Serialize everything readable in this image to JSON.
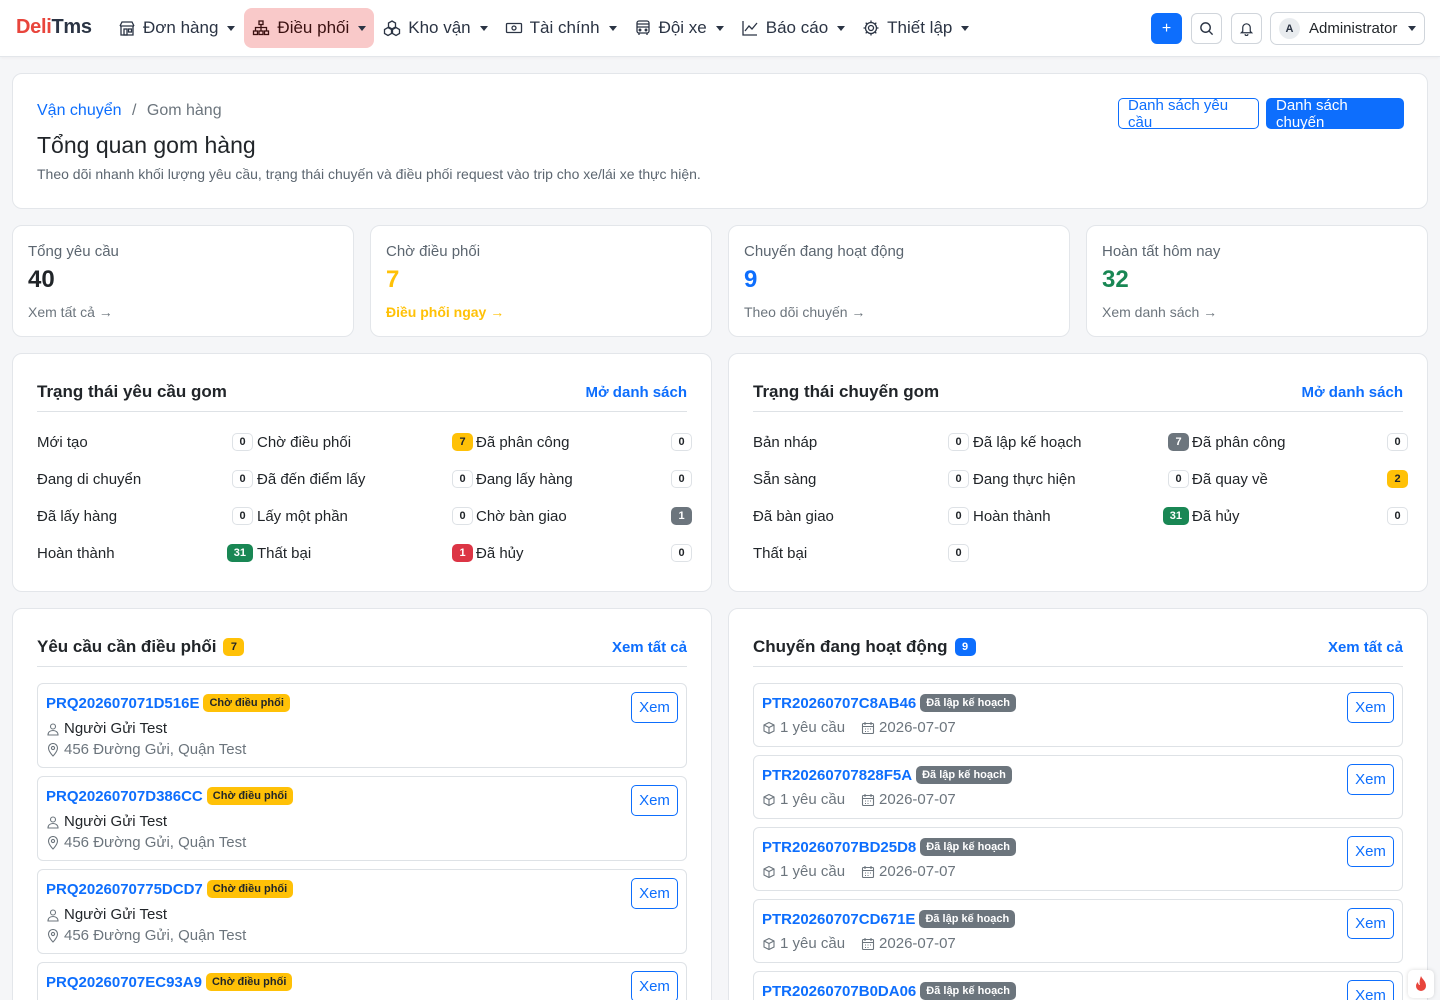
{
  "brand": {
    "part1": "Deli",
    "part2": "Tms"
  },
  "nav": [
    {
      "label": "Đơn hàng",
      "icon": "store-icon",
      "active": false
    },
    {
      "label": "Điều phối",
      "icon": "sitemap-icon",
      "active": true
    },
    {
      "label": "Kho vận",
      "icon": "boxes-icon",
      "active": false
    },
    {
      "label": "Tài chính",
      "icon": "cash-icon",
      "active": false
    },
    {
      "label": "Đội xe",
      "icon": "bus-icon",
      "active": false
    },
    {
      "label": "Báo cáo",
      "icon": "chart-line-icon",
      "active": false
    },
    {
      "label": "Thiết lập",
      "icon": "gear-icon",
      "active": false
    }
  ],
  "topbar": {
    "add_label": "+",
    "user_initial": "A",
    "user_name": "Administrator"
  },
  "header": {
    "breadcrumb_root": "Vận chuyển",
    "breadcrumb_sep": "/",
    "breadcrumb_current": "Gom hàng",
    "title": "Tổng quan gom hàng",
    "description": "Theo dõi nhanh khối lượng yêu cầu, trạng thái chuyến và điều phối request vào trip cho xe/lái xe thực hiện.",
    "btn_requests": "Danh sách yêu cầu",
    "btn_trips": "Danh sách chuyến"
  },
  "stats": [
    {
      "label": "Tổng yêu cầu",
      "value": "40",
      "link": "Xem tất cả →",
      "color": "#212529",
      "link_color": "#6c757d"
    },
    {
      "label": "Chờ điều phối",
      "value": "7",
      "link": "Điều phối ngay →",
      "color": "#ffc107",
      "link_color": "#ffc107"
    },
    {
      "label": "Chuyến đang hoạt động",
      "value": "9",
      "link": "Theo dõi chuyến →",
      "color": "#0d6efd",
      "link_color": "#6c757d"
    },
    {
      "label": "Hoàn tất hôm nay",
      "value": "32",
      "link": "Xem danh sách →",
      "color": "#198754",
      "link_color": "#6c757d"
    }
  ],
  "request_status": {
    "title": "Trạng thái yêu cầu gom",
    "link": "Mở danh sách",
    "items": [
      {
        "label": "Mới tạo",
        "count": "0",
        "style": ""
      },
      {
        "label": "Chờ điều phối",
        "count": "7",
        "style": "y"
      },
      {
        "label": "Đã phân công",
        "count": "0",
        "style": ""
      },
      {
        "label": "Đang di chuyển",
        "count": "0",
        "style": ""
      },
      {
        "label": "Đã đến điểm lấy",
        "count": "0",
        "style": ""
      },
      {
        "label": "Đang lấy hàng",
        "count": "0",
        "style": ""
      },
      {
        "label": "Đã lấy hàng",
        "count": "0",
        "style": ""
      },
      {
        "label": "Lấy một phần",
        "count": "0",
        "style": ""
      },
      {
        "label": "Chờ bàn giao",
        "count": "1",
        "style": "gr"
      },
      {
        "label": "Hoàn thành",
        "count": "31",
        "style": "g"
      },
      {
        "label": "Thất bại",
        "count": "1",
        "style": "r"
      },
      {
        "label": "Đã hủy",
        "count": "0",
        "style": ""
      }
    ]
  },
  "trip_status": {
    "title": "Trạng thái chuyến gom",
    "link": "Mở danh sách",
    "items": [
      {
        "label": "Bản nháp",
        "count": "0",
        "style": ""
      },
      {
        "label": "Đã lập kế hoạch",
        "count": "7",
        "style": "gr"
      },
      {
        "label": "Đã phân công",
        "count": "0",
        "style": ""
      },
      {
        "label": "Sẵn sàng",
        "count": "0",
        "style": ""
      },
      {
        "label": "Đang thực hiện",
        "count": "0",
        "style": ""
      },
      {
        "label": "Đã quay về",
        "count": "2",
        "style": "y"
      },
      {
        "label": "Đã bàn giao",
        "count": "0",
        "style": ""
      },
      {
        "label": "Hoàn thành",
        "count": "31",
        "style": "g"
      },
      {
        "label": "Đã hủy",
        "count": "0",
        "style": ""
      },
      {
        "label": "Thất bại",
        "count": "0",
        "style": ""
      }
    ]
  },
  "pending_requests": {
    "title": "Yêu cầu cần điều phối",
    "count": "7",
    "link": "Xem tất cả",
    "view_label": "Xem",
    "items": [
      {
        "code": "PRQ202607071D516E",
        "status": "Chờ điều phối",
        "sender": "Người Gửi Test",
        "address": "456 Đường Gửi, Quận Test"
      },
      {
        "code": "PRQ20260707D386CC",
        "status": "Chờ điều phối",
        "sender": "Người Gửi Test",
        "address": "456 Đường Gửi, Quận Test"
      },
      {
        "code": "PRQ2026070775DCD7",
        "status": "Chờ điều phối",
        "sender": "Người Gửi Test",
        "address": "456 Đường Gửi, Quận Test"
      },
      {
        "code": "PRQ20260707EC93A9",
        "status": "Chờ điều phối",
        "sender": "",
        "address": ""
      }
    ]
  },
  "active_trips": {
    "title": "Chuyến đang hoạt động",
    "count": "9",
    "link": "Xem tất cả",
    "view_label": "Xem",
    "items": [
      {
        "code": "PTR20260707C8AB46",
        "status": "Đã lập kế hoạch",
        "requests": "1 yêu cầu",
        "date": "2026-07-07"
      },
      {
        "code": "PTR20260707828F5A",
        "status": "Đã lập kế hoạch",
        "requests": "1 yêu cầu",
        "date": "2026-07-07"
      },
      {
        "code": "PTR20260707BD25D8",
        "status": "Đã lập kế hoạch",
        "requests": "1 yêu cầu",
        "date": "2026-07-07"
      },
      {
        "code": "PTR20260707CD671E",
        "status": "Đã lập kế hoạch",
        "requests": "1 yêu cầu",
        "date": "2026-07-07"
      },
      {
        "code": "PTR20260707B0DA06",
        "status": "Đã lập kế hoạch",
        "requests": "",
        "date": ""
      }
    ]
  }
}
